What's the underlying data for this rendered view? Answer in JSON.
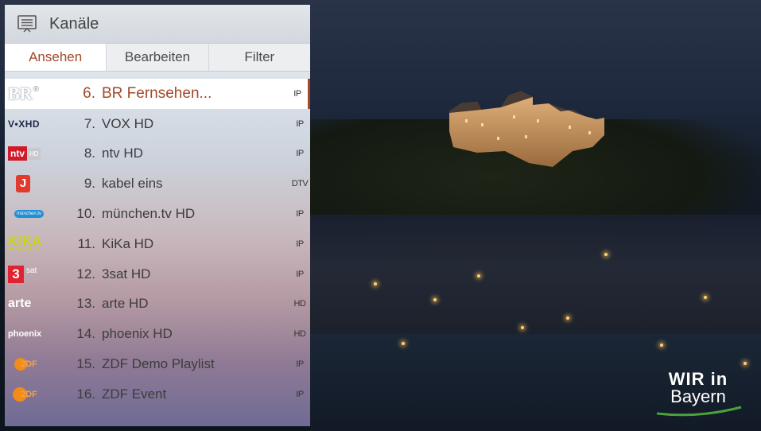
{
  "panel": {
    "title": "Kanäle",
    "tabs": [
      {
        "label": "Ansehen"
      },
      {
        "label": "Bearbeiten"
      },
      {
        "label": "Filter"
      }
    ]
  },
  "channels": [
    {
      "logo": "BR",
      "number": "6.",
      "name": "BR Fernsehen...",
      "tag": "IP"
    },
    {
      "logo": "VOXHD",
      "number": "7.",
      "name": "VOX HD",
      "tag": "IP"
    },
    {
      "logo": "ntv HD",
      "number": "8.",
      "name": "ntv HD",
      "tag": "IP"
    },
    {
      "logo": "kabel eins",
      "number": "9.",
      "name": "kabel eins",
      "tag": "DTV"
    },
    {
      "logo": "münchen.tv",
      "number": "10.",
      "name": "münchen.tv HD",
      "tag": "IP"
    },
    {
      "logo": "KiKA",
      "number": "11.",
      "name": "KiKa HD",
      "tag": "IP"
    },
    {
      "logo": "3sat",
      "number": "12.",
      "name": "3sat HD",
      "tag": "IP"
    },
    {
      "logo": "arte",
      "number": "13.",
      "name": "arte HD",
      "tag": "HD"
    },
    {
      "logo": "phoenix",
      "number": "14.",
      "name": "phoenix HD",
      "tag": "HD"
    },
    {
      "logo": "ZDF",
      "number": "15.",
      "name": "ZDF Demo Playlist",
      "tag": "IP"
    },
    {
      "logo": "ZDF",
      "number": "16.",
      "name": "ZDF Event",
      "tag": "IP"
    }
  ],
  "logos": {
    "br_sup": "®",
    "vox": "V•XHD",
    "ntv": "ntv",
    "ntv_hd": "HD",
    "kabel": "J",
    "muenchen": "münchen.tv",
    "kika": "KiKA",
    "kika_sub": "von ARD und ZDF",
    "sat_num": "3",
    "sat_text": "sat",
    "arte": "arte",
    "phoenix": "phoenix",
    "zdf": "2DF"
  },
  "watermark": {
    "line1": "WIR in",
    "line2": "Bayern"
  },
  "colors": {
    "accent": "#a34828",
    "selected_bg": "#ffffff"
  },
  "icons": {
    "header": "tv-list-icon"
  }
}
